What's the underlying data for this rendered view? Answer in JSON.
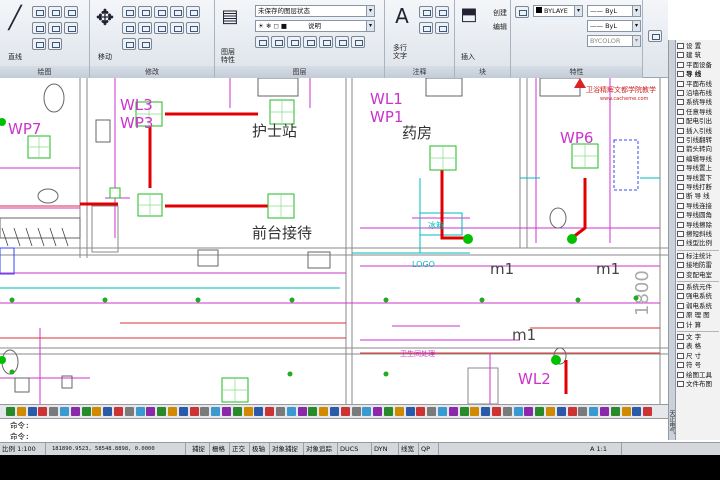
{
  "ribbon": {
    "draw_panel_title": "绘图",
    "modify_panel_title": "修改",
    "layers_panel_title": "图层",
    "annotation_panel_title": "注释",
    "block_panel_title": "块",
    "properties_panel_title": "特性",
    "line_label": "直线",
    "move_label": "移动",
    "layer_props_label": "图层\n特性",
    "layer_combo_value": "未保存的图层状态",
    "layer_name_value": "说明",
    "mtext_label": "多行\n文字",
    "insert_label": "插入",
    "create_label": "创建",
    "edit_label": "编辑",
    "bylayer_color": "BYLAYE",
    "bylayer_lineweight": "ByL",
    "bycolor": "BYCOLOR",
    "linetype_value": "ByL"
  },
  "drawing": {
    "rooms": {
      "nurse_station": "护士站",
      "front_desk": "前台接待",
      "pharmacy": "药房"
    },
    "panels": {
      "wp7": "WP7",
      "wl3": "WL3",
      "wp3": "WP3",
      "wl1": "WL1",
      "wp1": "WP1",
      "wp6": "WP6",
      "wl2": "WL2",
      "m1_a": "m1",
      "m1_b": "m1",
      "m1_c": "m1"
    },
    "small_notes": {
      "note_1": "冰箱",
      "note_2": "LOGO",
      "note_3": "卫生间处理"
    },
    "watermark_text": "卫浴精辉文都学院教学",
    "watermark_url": "www.cacheme.com"
  },
  "palette": {
    "items": [
      {
        "label": "设  置",
        "section": false
      },
      {
        "label": "建  筑",
        "section": false
      },
      {
        "label": "平面设备",
        "section": false
      },
      {
        "label": "导  线",
        "section": true
      },
      {
        "label": "平面布线",
        "section": false
      },
      {
        "label": "沿墙布线",
        "section": false
      },
      {
        "label": "系统导线",
        "section": false
      },
      {
        "label": "任意导线",
        "section": false
      },
      {
        "label": "配电引出",
        "section": false
      },
      {
        "label": "插入引线",
        "section": false
      },
      {
        "label": "引线翻转",
        "section": false
      },
      {
        "label": "箭头转向",
        "section": false
      },
      {
        "label": "编辑导线",
        "section": false
      },
      {
        "label": "导线置上",
        "section": false
      },
      {
        "label": "导线置下",
        "section": false
      },
      {
        "label": "导线打断",
        "section": false
      },
      {
        "label": "断 导 线",
        "section": false
      },
      {
        "label": "导线连接",
        "section": false
      },
      {
        "label": "导线圆角",
        "section": false
      },
      {
        "label": "导线擦除",
        "section": false
      },
      {
        "label": "擦短斜线",
        "section": false
      },
      {
        "label": "线型比例",
        "section": false
      },
      {
        "label": "标注统计",
        "section": false
      },
      {
        "label": "接地防雷",
        "section": false
      },
      {
        "label": "变配电室",
        "section": false
      },
      {
        "label": "系统元件",
        "section": false
      },
      {
        "label": "强电系统",
        "section": false
      },
      {
        "label": "弱电系统",
        "section": false
      },
      {
        "label": "原 理 图",
        "section": false
      },
      {
        "label": "计  算",
        "section": false
      },
      {
        "label": "文  字",
        "section": false
      },
      {
        "label": "表  格",
        "section": false
      },
      {
        "label": "尺  寸",
        "section": false
      },
      {
        "label": "符  号",
        "section": false
      },
      {
        "label": "绘图工具",
        "section": false
      },
      {
        "label": "文件布图",
        "section": false
      }
    ],
    "tab_label": "天正电气"
  },
  "command": {
    "line1": "命令:",
    "line2": "命令:"
  },
  "status": {
    "scale": "比例 1:100",
    "coordinates": "181890.9523, 58548.8898, 0.0000",
    "buttons": [
      "捕捉",
      "栅格",
      "正交",
      "极轴",
      "对象捕捉",
      "对象追踪",
      "DUCS",
      "DYN",
      "线宽",
      "QP"
    ],
    "annotation_scale": "A 1:1"
  },
  "colors": {
    "wire_red": "#e00000",
    "panel_green": "#00c000",
    "wall_magenta": "#cc33cc",
    "wall_gray": "#8a8a8a",
    "cyan": "#00bbbb"
  }
}
